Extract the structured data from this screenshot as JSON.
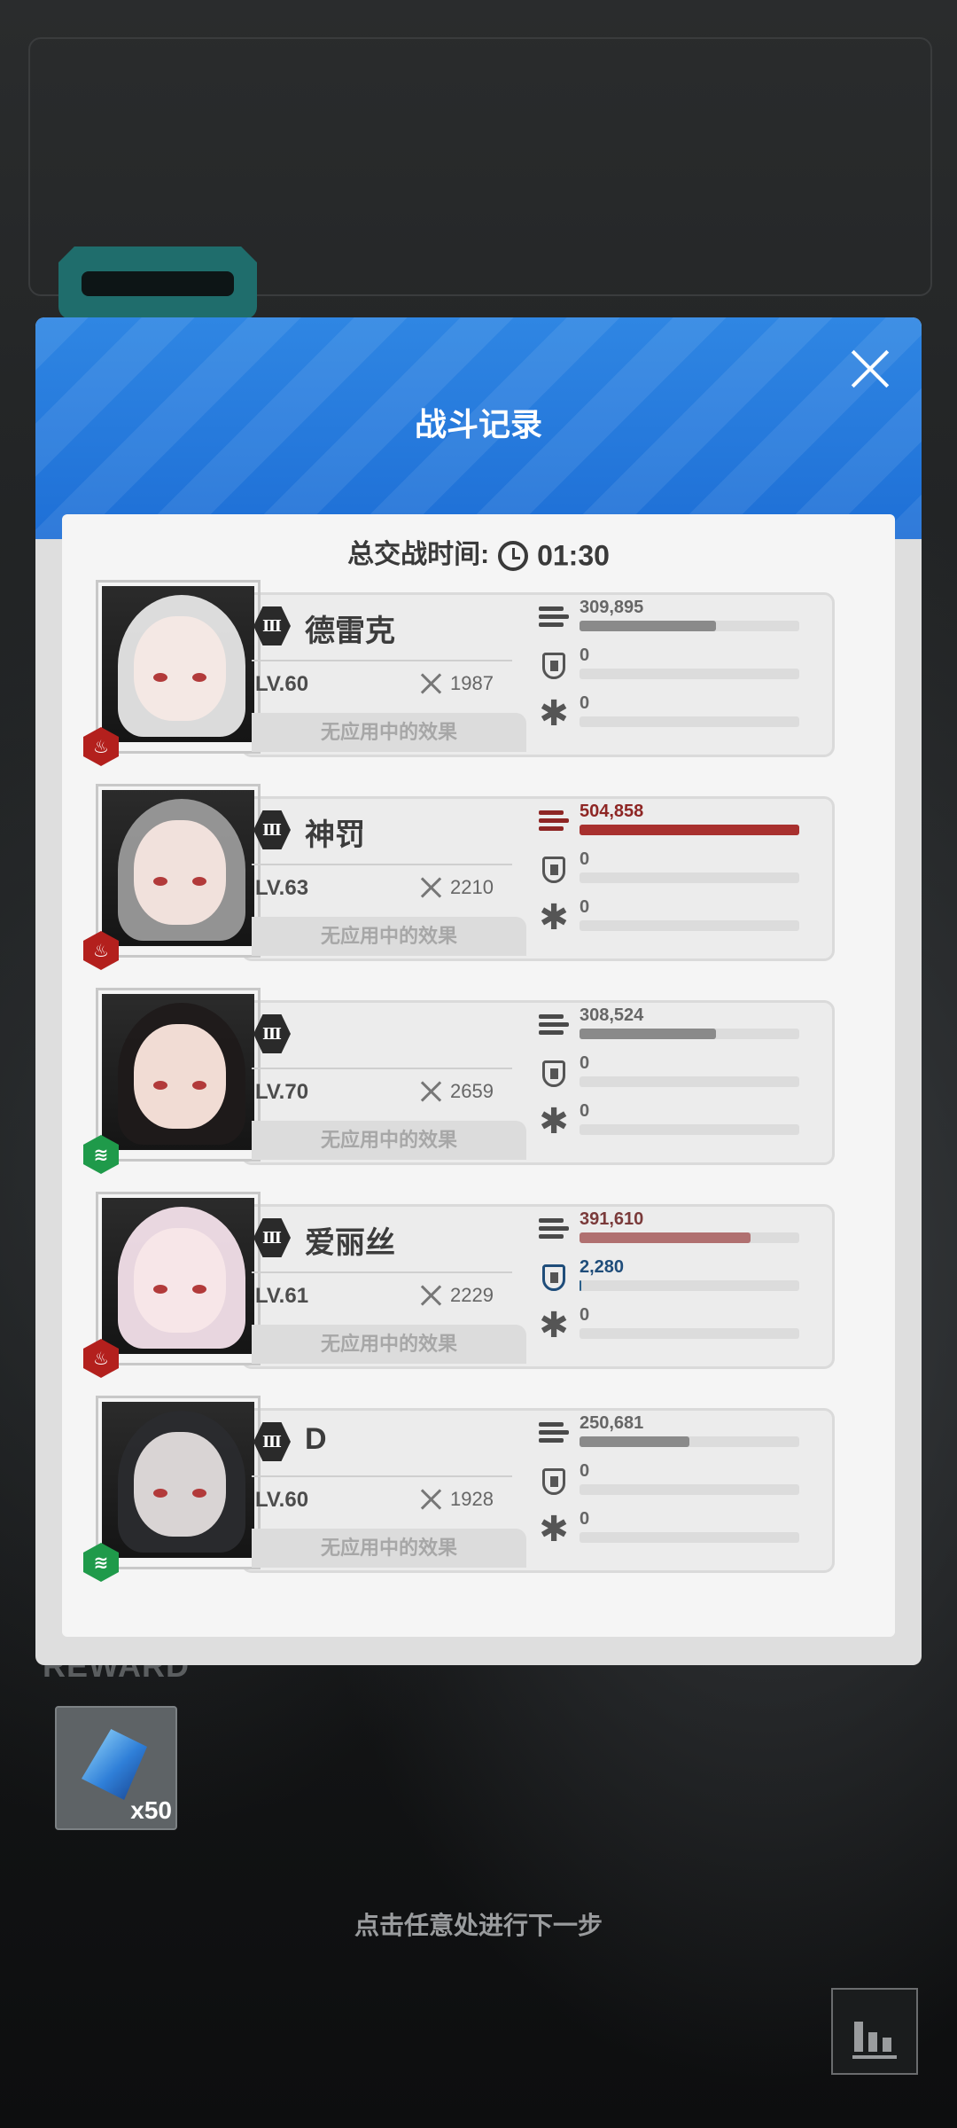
{
  "modal": {
    "title": "战斗记录",
    "battle_time_label": "总交战时间:",
    "battle_time": "01:30"
  },
  "empty_effect_label": "无应用中的效果",
  "characters": [
    {
      "rank": "Ⅲ",
      "name": "德雷克",
      "level": "LV.60",
      "power": "1987",
      "element": "fire",
      "damage": "309,895",
      "damage_fill": 0.62,
      "damage_color": "#8a8a8a",
      "shield": "0",
      "shield_fill": 0,
      "heal": "0",
      "heal_fill": 0,
      "palette": {
        "hair": "#e6e6e6",
        "face": "#f4e8e4"
      }
    },
    {
      "rank": "Ⅲ",
      "name": "神罚",
      "level": "LV.63",
      "power": "2210",
      "element": "fire",
      "damage": "504,858",
      "damage_fill": 1.0,
      "damage_color": "#a8302e",
      "shield": "0",
      "shield_fill": 0,
      "heal": "0",
      "heal_fill": 0,
      "palette": {
        "hair": "#9a9a9a",
        "face": "#f1e1dc"
      }
    },
    {
      "rank": "Ⅲ",
      "name": "",
      "level": "LV.70",
      "power": "2659",
      "element": "wind",
      "damage": "308,524",
      "damage_fill": 0.62,
      "damage_color": "#8a8a8a",
      "shield": "0",
      "shield_fill": 0,
      "heal": "0",
      "heal_fill": 0,
      "palette": {
        "hair": "#1f1a1a",
        "face": "#f1dcd4"
      }
    },
    {
      "rank": "Ⅲ",
      "name": "爱丽丝",
      "level": "LV.61",
      "power": "2229",
      "element": "fire",
      "damage": "391,610",
      "damage_fill": 0.78,
      "damage_color": "#b07070",
      "shield": "2,280",
      "shield_fill": 0.01,
      "heal": "0",
      "heal_fill": 0,
      "palette": {
        "hair": "#f3e0ea",
        "face": "#f7e6e8"
      }
    },
    {
      "rank": "Ⅲ",
      "name": "D",
      "level": "LV.60",
      "power": "1928",
      "element": "wind",
      "damage": "250,681",
      "damage_fill": 0.5,
      "damage_color": "#8a8a8a",
      "shield": "0",
      "shield_fill": 0,
      "heal": "0",
      "heal_fill": 0,
      "palette": {
        "hair": "#2a2b2e",
        "face": "#d9d4d4"
      }
    }
  ],
  "reward": {
    "title": "REWARD",
    "item_qty": "x50",
    "item_icon": "crystal-icon"
  },
  "continue_hint": "点击任意处进行下一步",
  "colors": {
    "header_blue": "#1e6fd6",
    "fire": "#b3201d",
    "wind": "#1f9a4a"
  }
}
